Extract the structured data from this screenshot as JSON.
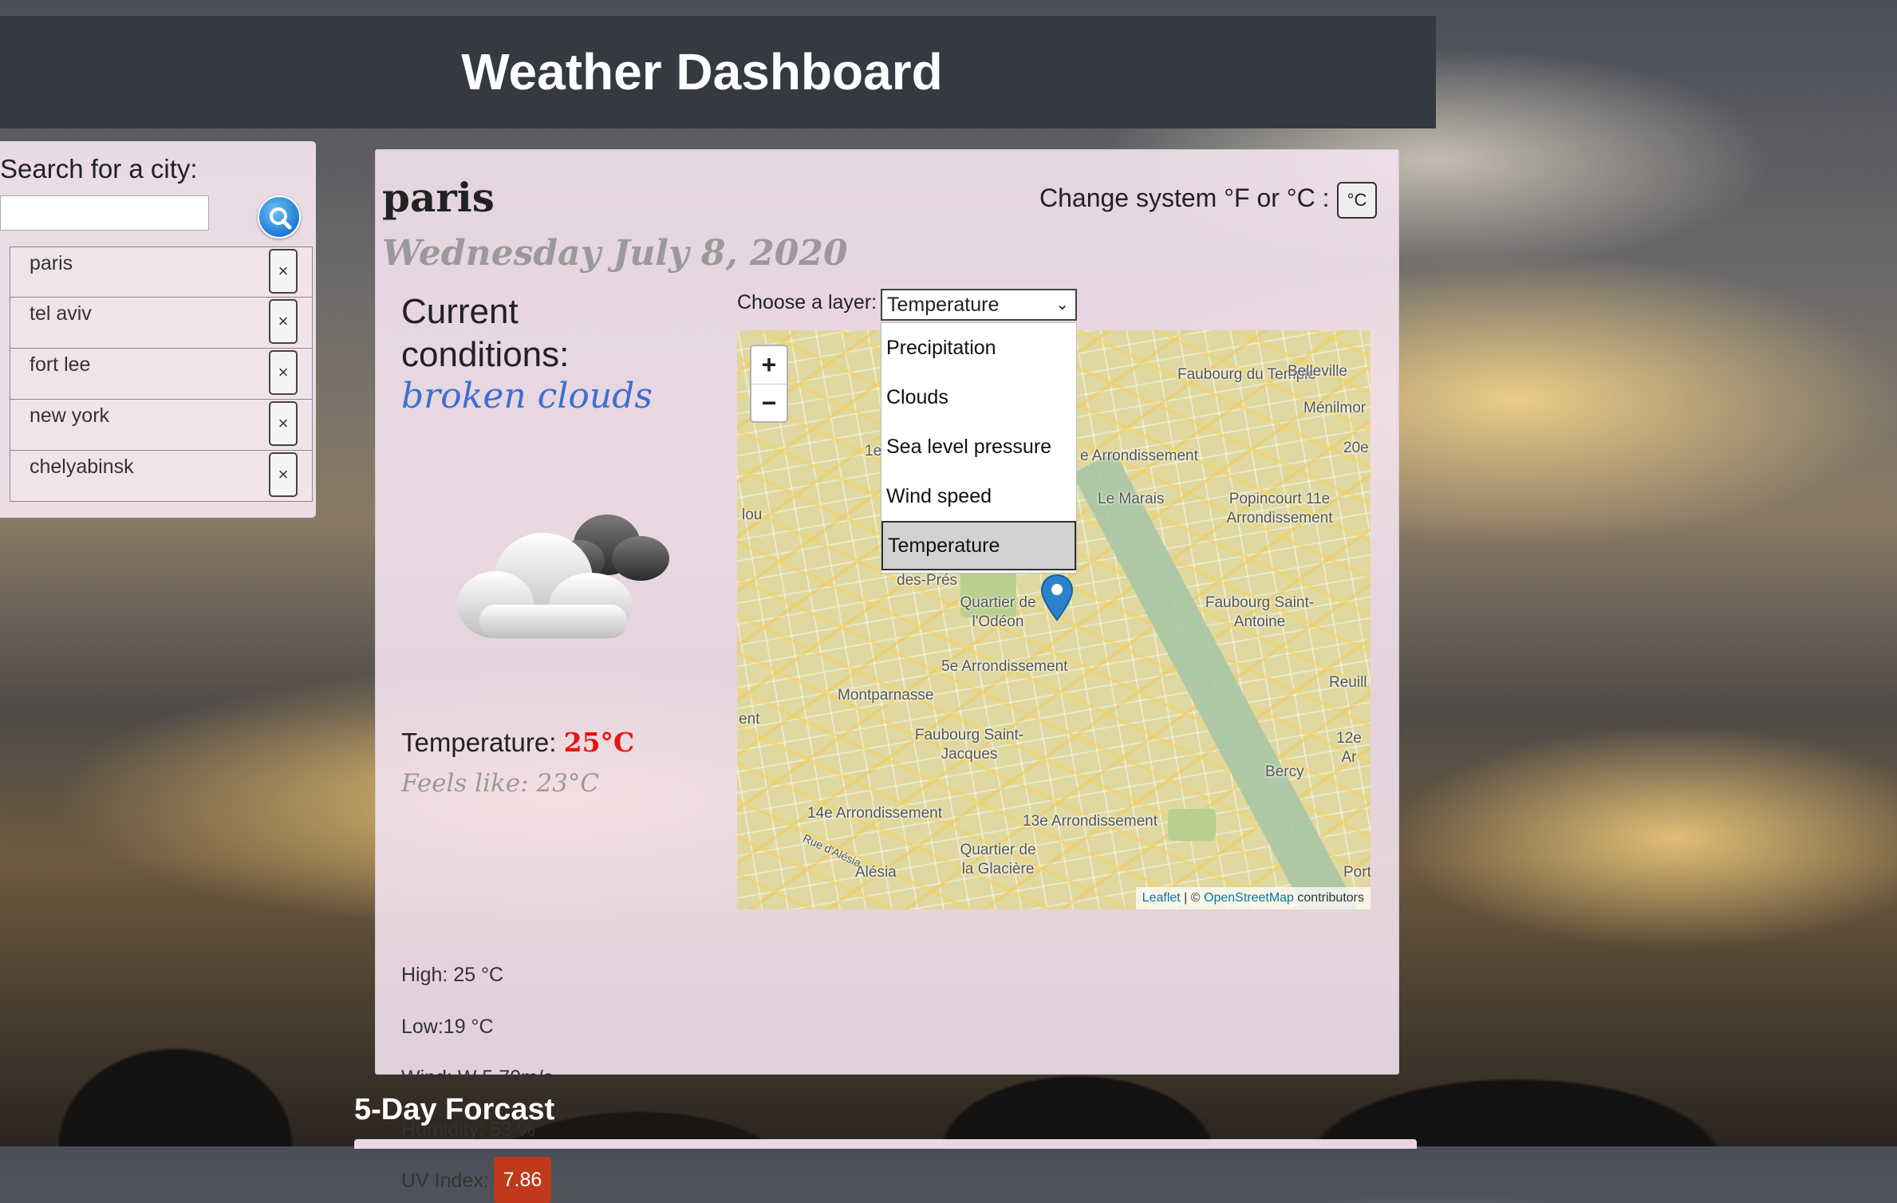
{
  "header": {
    "title": "Weather Dashboard"
  },
  "sidebar": {
    "title": "Search for a city:",
    "search_placeholder": "",
    "delete_glyph": "×",
    "cities": [
      "paris",
      "tel aviv",
      "fort lee",
      "new york",
      "chelyabinsk"
    ]
  },
  "main": {
    "city": "paris",
    "date": "Wednesday July 8, 2020",
    "unit_label": "Change system °F or °C :",
    "unit_button": "°C",
    "conditions_title": "Current conditions:",
    "conditions": "broken clouds",
    "weather_icon": "broken-clouds-icon",
    "temperature_label": "Temperature:",
    "temperature_value": "25°C",
    "feels_like": "Feels like: 23°C",
    "high": "High: 25 °C",
    "low": "Low:19 °C",
    "wind": "Wind: W 5.70m/s",
    "humidity": "Humidity: 53 %",
    "uv_label": "UV Index:",
    "uv_value": "7.86",
    "uv_color": "#c0391b"
  },
  "map": {
    "layer_label": "Choose a layer:",
    "selected_layer": "Temperature",
    "layer_options": [
      "Precipitation",
      "Clouds",
      "Sea level pressure",
      "Wind speed",
      "Temperature"
    ],
    "zoom_in": "+",
    "zoom_out": "−",
    "attribution_leaflet": "Leaflet",
    "attribution_sep": " | © ",
    "attribution_osm": "OpenStreetMap",
    "attribution_tail": " contributors",
    "labels": {
      "faubourg_du_temple": "Faubourg du Temple",
      "belleville": "Belleville",
      "menilmontant": "Ménilmor",
      "arr_3": "e Arrondissement",
      "arr_20": "20e",
      "le_marais": "Le Marais",
      "popincourt": "Popincourt 11e Arrondissement",
      "quartier_odeon": "Quartier de l'Odéon",
      "des_pres": "des-Prés",
      "faubourg_saint_antoine": "Faubourg Saint-Antoine",
      "arr_5": "5e Arrondissement",
      "montparnasse": "Montparnasse",
      "reuilly": "Reuill",
      "faubourg_saint_jacques": "Faubourg Saint-Jacques",
      "arr_12": "12e Ar",
      "bercy": "Bercy",
      "arr_14": "14e Arrondissement",
      "arr_13": "13e Arrondissement",
      "rue_alesia": "Rue d'Alésia",
      "alesia": "Alésia",
      "quartier_glaciere": "Quartier de la Glacière",
      "lou": "lou",
      "arr_1": "1e",
      "nt": "nt",
      "port": "Port",
      "ent": "ent"
    }
  },
  "forecast": {
    "title": "5-Day Forcast"
  }
}
